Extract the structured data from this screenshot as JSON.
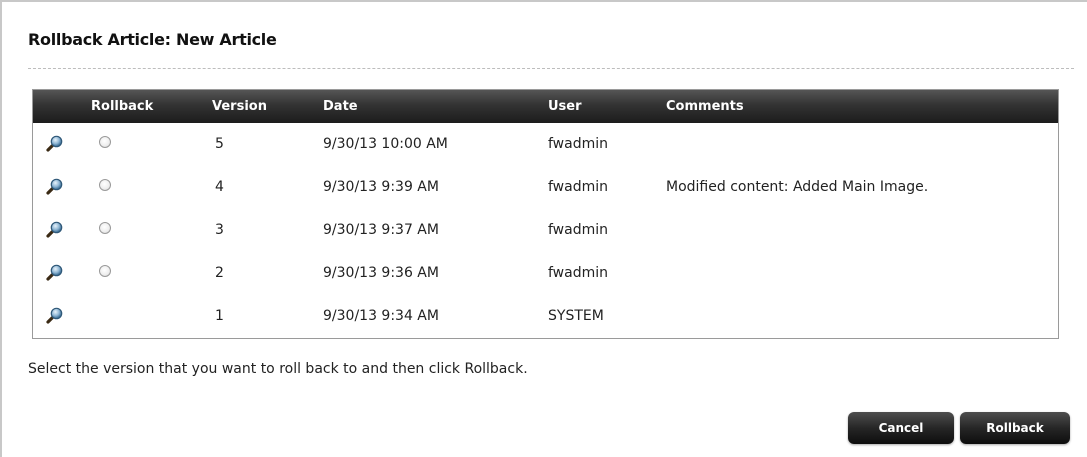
{
  "dialog": {
    "title": "Rollback Article: New Article",
    "instruction": "Select the version that you want to roll back to and then click Rollback."
  },
  "table": {
    "headers": {
      "rollback": "Rollback",
      "version": "Version",
      "date": "Date",
      "user": "User",
      "comments": "Comments"
    },
    "rows": [
      {
        "version": "5",
        "date": "9/30/13 10:00 AM",
        "user": "fwadmin",
        "comments": "",
        "has_radio": true,
        "selected": false
      },
      {
        "version": "4",
        "date": "9/30/13 9:39 AM",
        "user": "fwadmin",
        "comments": "Modified content: Added Main Image.",
        "has_radio": true,
        "selected": false
      },
      {
        "version": "3",
        "date": "9/30/13 9:37 AM",
        "user": "fwadmin",
        "comments": "",
        "has_radio": true,
        "selected": false
      },
      {
        "version": "2",
        "date": "9/30/13 9:36 AM",
        "user": "fwadmin",
        "comments": "",
        "has_radio": true,
        "selected": false
      },
      {
        "version": "1",
        "date": "9/30/13 9:34 AM",
        "user": "SYSTEM",
        "comments": "",
        "has_radio": false,
        "selected": false
      }
    ],
    "row_icon": "magnifier-icon"
  },
  "buttons": {
    "cancel": "Cancel",
    "rollback": "Rollback"
  },
  "colors": {
    "header_bg": "#2a2a2a",
    "button_bg": "#1e1e1e",
    "text": "#222222"
  }
}
